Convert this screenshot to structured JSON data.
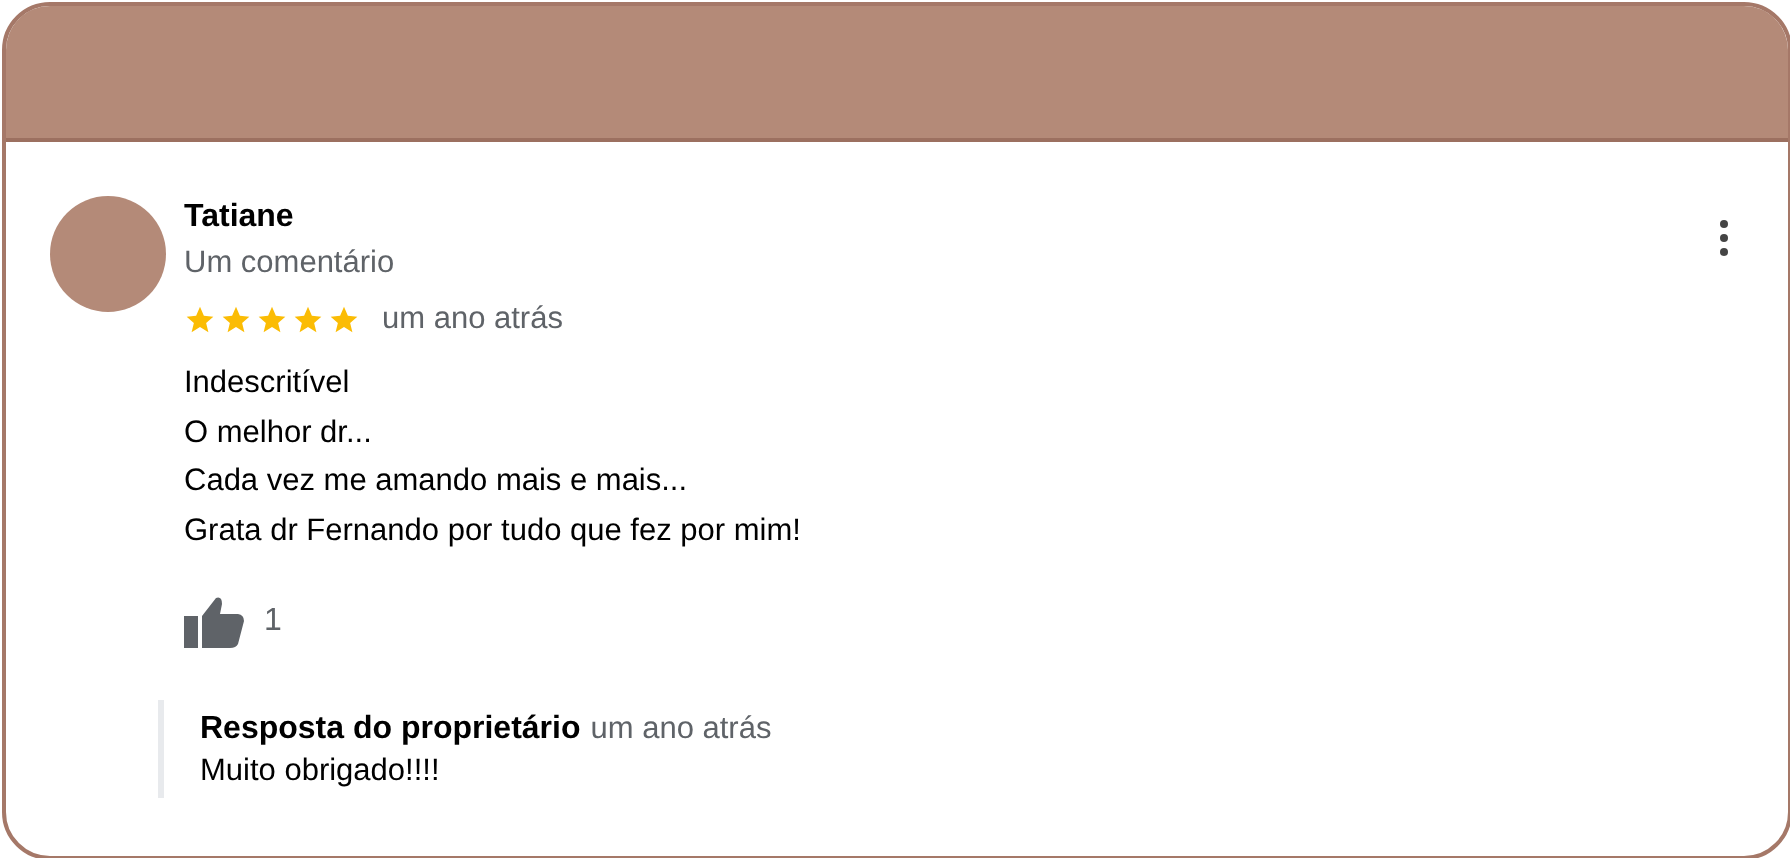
{
  "review": {
    "author": "Tatiane",
    "subtitle": "Um comentário",
    "stars": 5,
    "time": "um ano atrás",
    "lines": [
      "Indescritível",
      "O melhor dr...",
      "Cada vez me amando mais e mais...",
      "Grata dr Fernando por tudo que fez por mim!"
    ],
    "likes": "1"
  },
  "reply": {
    "title": "Resposta do proprietário",
    "time": "um ano atrás",
    "text": "Muito obrigado!!!!"
  }
}
